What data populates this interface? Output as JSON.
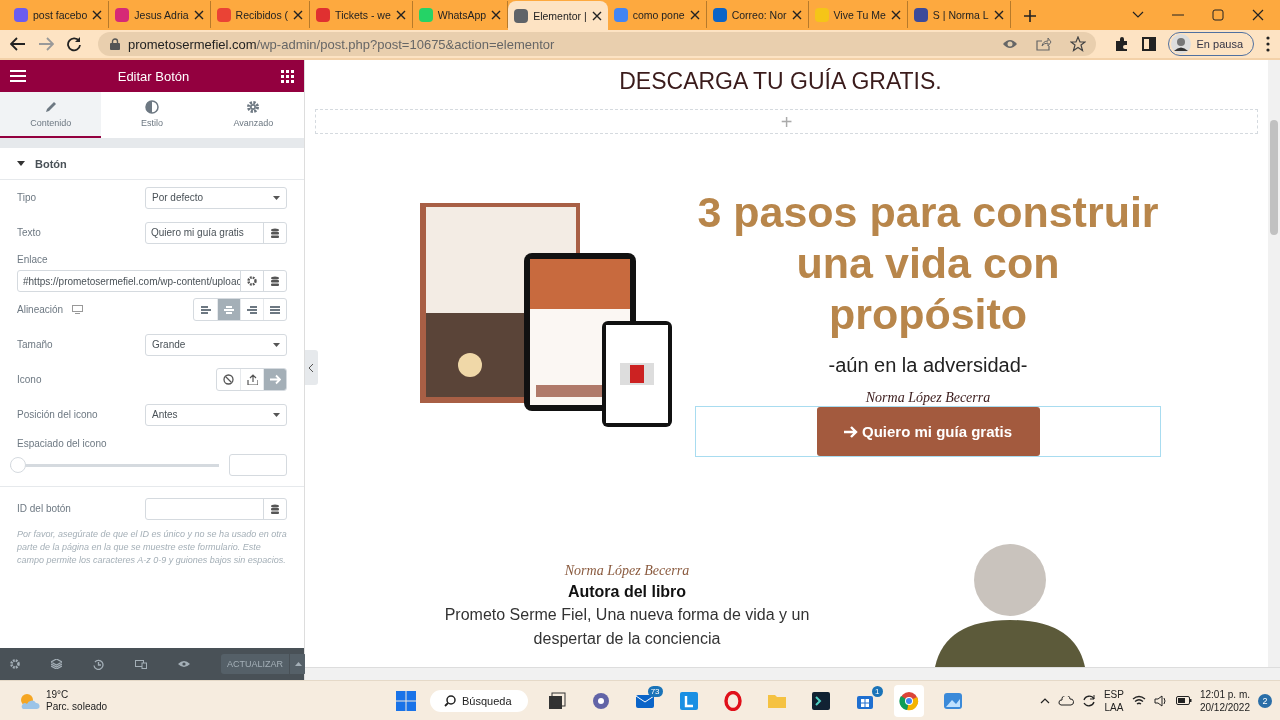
{
  "browser": {
    "tabs": [
      {
        "title": "post facebo",
        "color": "#6b5cf0",
        "selected": false
      },
      {
        "title": "Jesus Adria",
        "color": "#d62976",
        "selected": false
      },
      {
        "title": "Recibidos (",
        "color": "#ea4335",
        "selected": false
      },
      {
        "title": "Tickets - we",
        "color": "#e03030",
        "selected": false
      },
      {
        "title": "WhatsApp",
        "color": "#25d366",
        "selected": false
      },
      {
        "title": "Elementor |",
        "color": "#5f6368",
        "selected": true
      },
      {
        "title": "como pone",
        "color": "#4285f4",
        "selected": false
      },
      {
        "title": "Correo: Nor",
        "color": "#0a64c8",
        "selected": false
      },
      {
        "title": "Vive Tu Me",
        "color": "#f5c518",
        "selected": false
      },
      {
        "title": "S | Norma L",
        "color": "#3c4a9a",
        "selected": false
      }
    ],
    "url_domain": "prometosermefiel.com",
    "url_path": "/wp-admin/post.php?post=10675&action=elementor",
    "profile": "En pausa"
  },
  "panel": {
    "title": "Editar Botón",
    "tabs": [
      {
        "label": "Contenido",
        "kind": "content",
        "selected": true
      },
      {
        "label": "Estilo",
        "kind": "style",
        "selected": false
      },
      {
        "label": "Avanzado",
        "kind": "advanced",
        "selected": false
      }
    ],
    "section": {
      "title": "Botón",
      "expanded": true
    },
    "controls": [
      {
        "kind": "select",
        "label": "Tipo",
        "value": "Por defecto"
      },
      {
        "kind": "text",
        "label": "Texto",
        "value": "Quiero mi guía gratis"
      },
      {
        "kind": "url",
        "label": "Enlace",
        "value": "#https://prometosermefiel.com/wp-content/uploac"
      },
      {
        "kind": "align",
        "label": "Alineación",
        "options": [
          {
            "kind": "left",
            "selected": false
          },
          {
            "kind": "center",
            "selected": true
          },
          {
            "kind": "right",
            "selected": false
          },
          {
            "kind": "justify",
            "selected": false
          }
        ]
      },
      {
        "kind": "select",
        "label": "Tamaño",
        "value": "Grande"
      },
      {
        "kind": "icons",
        "label": "Icono",
        "options": [
          {
            "kind": "none",
            "selected": false
          },
          {
            "kind": "upload",
            "selected": false
          },
          {
            "kind": "arrow",
            "selected": true
          }
        ]
      },
      {
        "kind": "select",
        "label": "Posición del icono",
        "value": "Antes"
      },
      {
        "kind": "slider",
        "label": "Espaciado del icono",
        "level": 0
      },
      {
        "kind": "text",
        "label": "ID del botón"
      },
      {
        "kind": "help",
        "text": "Por favor, asegúrate de que el ID es único y no se ha usado en otra parte de la página en la que se muestre este formulario. Este campo permite los caracteres A-z 0-9 y guiones bajos sin espacios."
      }
    ],
    "update_label": "ACTUALIZAR"
  },
  "canvas": {
    "heading": "DESCARGA TU GUÍA GRATIS.",
    "add_section": "+",
    "title": "3 pasos para construir una vida con propósito",
    "subtitle": "-aún en la adversidad-",
    "signature": "Norma López Becerra",
    "button": "Quiero mi guía gratis",
    "author": {
      "signature": "Norma López Becerra",
      "role": "Autora del libro",
      "description": "Prometo Serme Fiel, Una nueva forma de vida y un despertar de la conciencia"
    }
  },
  "taskbar": {
    "temperature": "19°C",
    "weather": "Parc. soleado",
    "search": "Búsqueda",
    "apps": [
      {
        "kind": "taskview",
        "selected": false
      },
      {
        "kind": "chat",
        "selected": false
      },
      {
        "kind": "mail",
        "badge": "73",
        "selected": false
      },
      {
        "kind": "letter",
        "selected": false
      },
      {
        "kind": "opera",
        "selected": false
      },
      {
        "kind": "folder",
        "selected": false
      },
      {
        "kind": "terminal",
        "selected": false
      },
      {
        "kind": "store",
        "badge": "1",
        "selected": false
      },
      {
        "kind": "chrome",
        "selected": true
      },
      {
        "kind": "photos",
        "selected": false
      }
    ],
    "language": "ESP",
    "layout": "LAA",
    "time": "12:01 p. m.",
    "date": "20/12/2022",
    "notifications": "2"
  }
}
